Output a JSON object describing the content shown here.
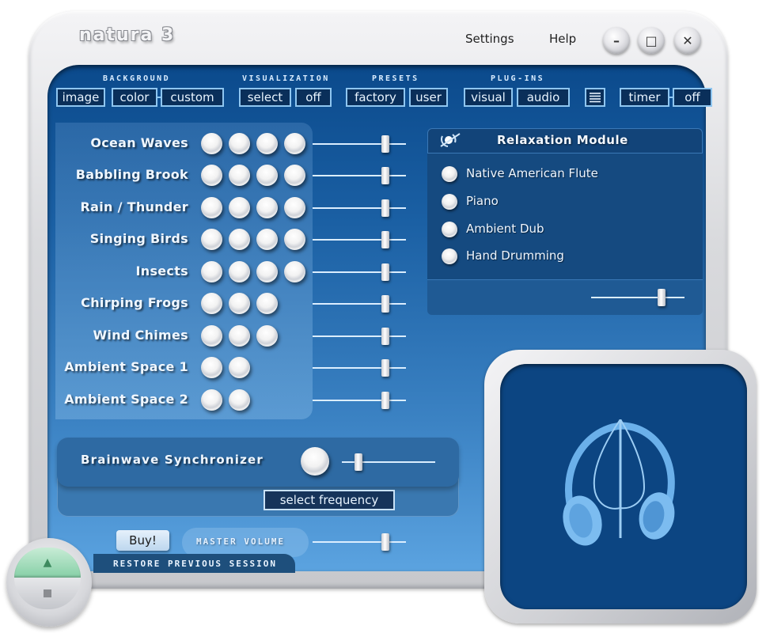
{
  "app": {
    "title": "natura 3"
  },
  "menu": {
    "settings": "Settings",
    "help": "Help"
  },
  "window_controls": {
    "minimize": "–",
    "maximize": "□",
    "close": "✕"
  },
  "toolbar": {
    "background": {
      "label": "BACKGROUND",
      "buttons": [
        "image",
        "color",
        "custom"
      ]
    },
    "visualization": {
      "label": "VISUALIZATION",
      "buttons": [
        "select",
        "off"
      ]
    },
    "presets": {
      "label": "PRESETS",
      "buttons": [
        "factory",
        "user"
      ]
    },
    "plugins": {
      "label": "PLUG-INS",
      "buttons": [
        "visual",
        "audio"
      ]
    },
    "list_icon": "list-icon",
    "timer": {
      "buttons": [
        "timer",
        "off"
      ]
    }
  },
  "sounds": [
    {
      "label": "Ocean Waves",
      "variants": 4,
      "volume": 0.78
    },
    {
      "label": "Babbling Brook",
      "variants": 4,
      "volume": 0.78
    },
    {
      "label": "Rain / Thunder",
      "variants": 4,
      "volume": 0.78
    },
    {
      "label": "Singing Birds",
      "variants": 4,
      "volume": 0.78
    },
    {
      "label": "Insects",
      "variants": 4,
      "volume": 0.78
    },
    {
      "label": "Chirping Frogs",
      "variants": 3,
      "volume": 0.78
    },
    {
      "label": "Wind Chimes",
      "variants": 3,
      "volume": 0.78
    },
    {
      "label": "Ambient Space 1",
      "variants": 2,
      "volume": 0.78
    },
    {
      "label": "Ambient Space 2",
      "variants": 2,
      "volume": 0.78
    }
  ],
  "relaxation": {
    "title": "Relaxation Module",
    "items": [
      "Native American Flute",
      "Piano",
      "Ambient Dub",
      "Hand Drumming"
    ],
    "volume": 0.75
  },
  "brainwave": {
    "label": "Brainwave Synchronizer",
    "select_label": "select frequency",
    "level": 0.18
  },
  "bottom": {
    "buy_label": "Buy!",
    "master_volume_label": "MASTER VOLUME",
    "master_volume": 0.78,
    "restore_label": "RESTORE PREVIOUS SESSION"
  },
  "player": {
    "play": "▲"
  },
  "visual": {
    "icon": "headphones-leaf-logo"
  },
  "colors": {
    "panel": "#1a5fa3",
    "button_border": "#8fc6f0",
    "button_bg": "#0a2f5a",
    "play_green": "#86cfa6"
  }
}
